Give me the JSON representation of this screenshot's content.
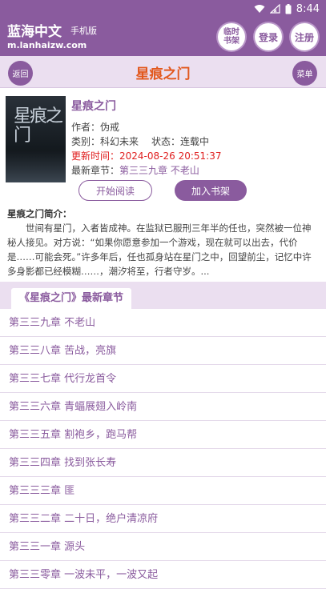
{
  "status": {
    "time": "8:44"
  },
  "header": {
    "site_title": "蓝海中文",
    "site_subtitle": "手机版",
    "site_url": "m.lanhaizw.com",
    "temp_shelf_line1": "临时",
    "temp_shelf_line2": "书架",
    "login_label": "登录",
    "register_label": "注册"
  },
  "titlebar": {
    "back_label": "返回",
    "title": "星痕之门",
    "menu_label": "菜单"
  },
  "book": {
    "cover_text": "星痕之门",
    "name": "星痕之门",
    "author_label": "作者：",
    "author": "伪戒",
    "category_label": "类别：",
    "category": "科幻未来",
    "status_label": "状态：",
    "status": "连载中",
    "updated_label": "更新时间：",
    "updated": "2024-08-26 20:51:37",
    "latest_label": "最新章节：",
    "latest": "第三三九章 不老山"
  },
  "actions": {
    "read_label": "开始阅读",
    "shelf_label": "加入书架"
  },
  "intro": {
    "label": "星痕之门简介：",
    "text": "世间有星门，入者皆成神。在监狱已服刑三年半的任也，突然被一位神秘人接见。对方说：“如果你愿意参加一个游戏，现在就可以出去，代价是……可能会死。”许多年后，任也孤身站在星门之中，回望前尘，记忆中许多身影都已经模糊……，潮汐将至，行者守岁。..."
  },
  "chapters": {
    "section_title": "《星痕之门》最新章节",
    "items": [
      "第三三九章 不老山",
      "第三三八章 苦战，亮旗",
      "第三三七章 代行龙首令",
      "第三三六章 青蝠展翅入岭南",
      "第三三五章 割袍乡，跑马帮",
      "第三三四章 找到张长寿",
      "第三三三章 匪",
      "第三三二章 二十日，绝户清凉府",
      "第三三一章 源头",
      "第三三零章 一波未平，一波又起"
    ]
  },
  "colors": {
    "brand": "#8a5b9e",
    "accent": "#e2581d",
    "update": "#e02020"
  }
}
